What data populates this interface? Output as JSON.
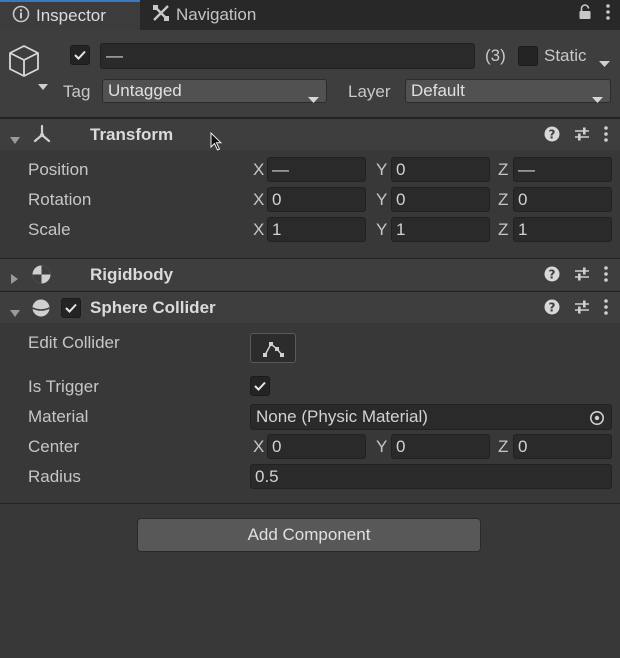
{
  "tabs": {
    "inspector": "Inspector",
    "navigation": "Navigation"
  },
  "header": {
    "object_name": "—",
    "count": "(3)",
    "static_label": "Static",
    "tag_label": "Tag",
    "tag_value": "Untagged",
    "layer_label": "Layer",
    "layer_value": "Default"
  },
  "transform": {
    "title": "Transform",
    "position_label": "Position",
    "rotation_label": "Rotation",
    "scale_label": "Scale",
    "axis_x": "X",
    "axis_y": "Y",
    "axis_z": "Z",
    "position": [
      "—",
      "0",
      "—"
    ],
    "rotation": [
      "0",
      "0",
      "0"
    ],
    "scale": [
      "1",
      "1",
      "1"
    ]
  },
  "rigidbody": {
    "title": "Rigidbody"
  },
  "sphere_collider": {
    "title": "Sphere Collider",
    "edit_collider_label": "Edit Collider",
    "is_trigger_label": "Is Trigger",
    "material_label": "Material",
    "material_value": "None (Physic Material)",
    "center_label": "Center",
    "center": [
      "0",
      "0",
      "0"
    ],
    "radius_label": "Radius",
    "radius_value": "0.5"
  },
  "add_component_label": "Add Component",
  "colors": {
    "background": "#383838",
    "tab_accent": "#3a79bb",
    "field_bg": "#2a2a2a"
  }
}
